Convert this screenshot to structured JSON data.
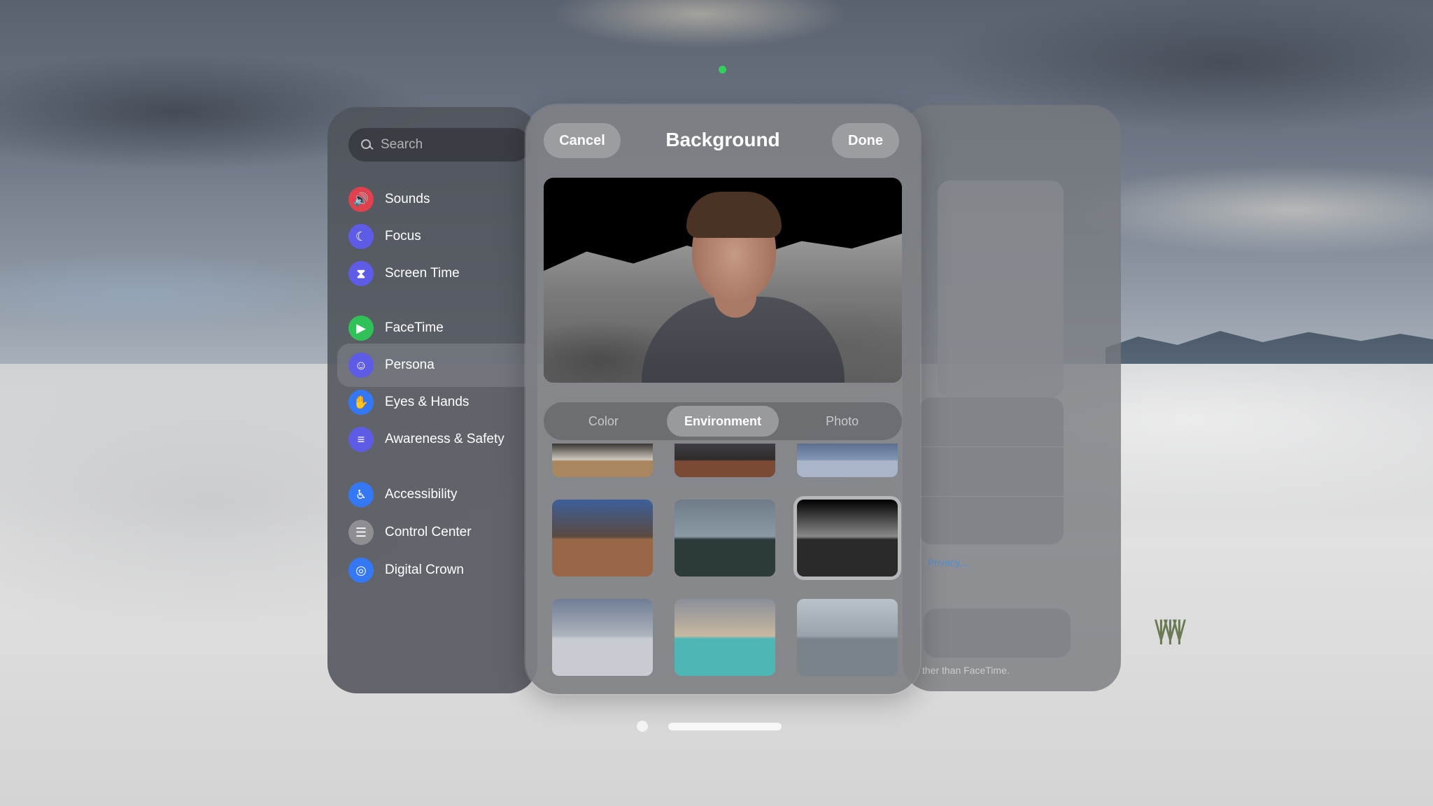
{
  "settings": {
    "search_placeholder": "Search",
    "items": [
      {
        "label": "Sounds",
        "icon": "speaker-icon",
        "color": "#e0414f",
        "glyph": "🔊"
      },
      {
        "label": "Focus",
        "icon": "moon-icon",
        "color": "#5e5ce6",
        "glyph": "☾"
      },
      {
        "label": "Screen Time",
        "icon": "hourglass-icon",
        "color": "#5e5ce6",
        "glyph": "⧗"
      },
      {
        "label": "FaceTime",
        "icon": "video-camera-icon",
        "color": "#30c158",
        "glyph": "▶"
      },
      {
        "label": "Persona",
        "icon": "persona-icon",
        "color": "#5e5ce6",
        "glyph": "☺",
        "selected": true
      },
      {
        "label": "Eyes & Hands",
        "icon": "hand-icon",
        "color": "#3478f6",
        "glyph": "✋"
      },
      {
        "label": "Awareness & Safety",
        "icon": "awareness-icon",
        "color": "#5e5ce6",
        "glyph": "≡"
      },
      {
        "label": "Accessibility",
        "icon": "accessibility-icon",
        "color": "#3478f6",
        "glyph": "♿"
      },
      {
        "label": "Control Center",
        "icon": "toggles-icon",
        "color": "#8e8e93",
        "glyph": "☰"
      },
      {
        "label": "Digital Crown",
        "icon": "digital-crown-icon",
        "color": "#3478f6",
        "glyph": "◎"
      }
    ]
  },
  "modal": {
    "title": "Background",
    "cancel_label": "Cancel",
    "done_label": "Done",
    "tabs": [
      {
        "label": "Color",
        "active": false
      },
      {
        "label": "Environment",
        "active": true
      },
      {
        "label": "Photo",
        "active": false
      }
    ],
    "environments": [
      {
        "name": "room-interior",
        "colors": [
          "#3a3632",
          "#a9865f",
          "#cfc9c0"
        ],
        "row": 0
      },
      {
        "name": "canyon-dusk",
        "colors": [
          "#3f3e46",
          "#7a4a35",
          "#2f2b2a"
        ],
        "row": 0
      },
      {
        "name": "winter-lake",
        "colors": [
          "#5d6f8f",
          "#aab5c9",
          "#8096b4"
        ],
        "row": 0
      },
      {
        "name": "joshua-tree",
        "colors": [
          "#3d5f9a",
          "#9a6648",
          "#5a4a40"
        ],
        "row": 1
      },
      {
        "name": "mount-hood",
        "colors": [
          "#6f7c87",
          "#2d3a3a",
          "#8a9aa5"
        ],
        "row": 1
      },
      {
        "name": "moon",
        "colors": [
          "#000000",
          "#2a2a2a",
          "#8a8a8a"
        ],
        "row": 1,
        "selected": true
      },
      {
        "name": "white-sands",
        "colors": [
          "#6f7d95",
          "#c8ccd2",
          "#aeb4bd"
        ],
        "row": 2
      },
      {
        "name": "haleakala",
        "colors": [
          "#8a8f99",
          "#4fb6b6",
          "#c8b8a0"
        ],
        "row": 2
      },
      {
        "name": "foggy-lake",
        "colors": [
          "#b9c1c9",
          "#7a8389",
          "#9aa3ab"
        ],
        "row": 2
      }
    ]
  },
  "back_window": {
    "link_text": "Privacy...",
    "footer_text": "ther than FaceTime."
  }
}
